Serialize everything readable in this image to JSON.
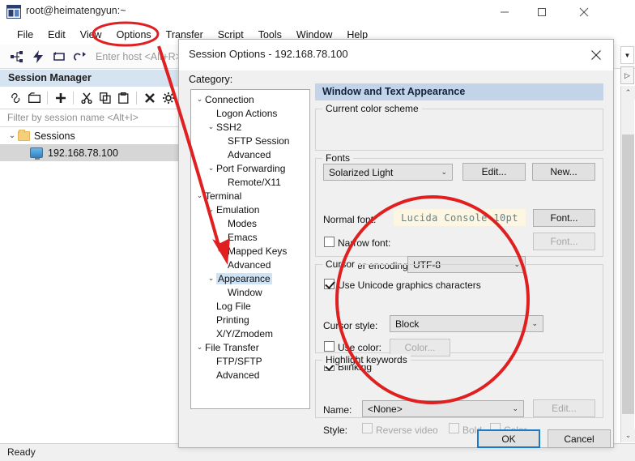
{
  "window": {
    "title": "root@heimatengyun:~",
    "app_icon": "terminal-window-icon",
    "minimize": "—",
    "maximize": "□",
    "close": "✕",
    "status": "Ready"
  },
  "menubar": {
    "items": [
      {
        "label": "File"
      },
      {
        "label": "Edit"
      },
      {
        "label": "View"
      },
      {
        "label": "Options"
      },
      {
        "label": "Transfer"
      },
      {
        "label": "Script"
      },
      {
        "label": "Tools"
      },
      {
        "label": "Window"
      },
      {
        "label": "Help"
      }
    ]
  },
  "toolbar": {
    "icons": [
      "connect-icon",
      "quick-connect-icon",
      "reconnect-icon",
      "connect-sftp-icon"
    ],
    "host_placeholder": "Enter host <Alt+R>"
  },
  "session_manager": {
    "header": "Session Manager",
    "toolbar_icons": [
      "link-icon",
      "new-folder-icon",
      "add-icon",
      "cut-icon",
      "copy-icon",
      "paste-icon",
      "delete-icon",
      "properties-gear-icon"
    ],
    "filter_placeholder": "Filter by session name <Alt+I>",
    "tree": {
      "root_label": "Sessions",
      "root_icon": "folder-icon",
      "root_chevron": "⌄",
      "children": [
        {
          "label": "192.168.78.100",
          "icon": "monitor-icon",
          "selected": true
        }
      ]
    }
  },
  "dialog": {
    "title": "Session Options - 192.168.78.100",
    "close_icon": "✕",
    "category_label": "Category:",
    "category_tree": [
      {
        "label": "Connection",
        "indent": 0,
        "chevron": "⌄"
      },
      {
        "label": "Logon Actions",
        "indent": 1,
        "chevron": ""
      },
      {
        "label": "SSH2",
        "indent": 1,
        "chevron": "⌄"
      },
      {
        "label": "SFTP Session",
        "indent": 2,
        "chevron": ""
      },
      {
        "label": "Advanced",
        "indent": 2,
        "chevron": ""
      },
      {
        "label": "Port Forwarding",
        "indent": 1,
        "chevron": "⌄"
      },
      {
        "label": "Remote/X11",
        "indent": 2,
        "chevron": ""
      },
      {
        "label": "Terminal",
        "indent": 0,
        "chevron": "⌄"
      },
      {
        "label": "Emulation",
        "indent": 1,
        "chevron": "⌄"
      },
      {
        "label": "Modes",
        "indent": 2,
        "chevron": ""
      },
      {
        "label": "Emacs",
        "indent": 2,
        "chevron": ""
      },
      {
        "label": "Mapped Keys",
        "indent": 2,
        "chevron": ""
      },
      {
        "label": "Advanced",
        "indent": 2,
        "chevron": ""
      },
      {
        "label": "Appearance",
        "indent": 1,
        "chevron": "⌄",
        "selected": true
      },
      {
        "label": "Window",
        "indent": 2,
        "chevron": ""
      },
      {
        "label": "Log File",
        "indent": 1,
        "chevron": ""
      },
      {
        "label": "Printing",
        "indent": 1,
        "chevron": ""
      },
      {
        "label": "X/Y/Zmodem",
        "indent": 1,
        "chevron": ""
      },
      {
        "label": "File Transfer",
        "indent": 0,
        "chevron": "⌄"
      },
      {
        "label": "FTP/SFTP",
        "indent": 1,
        "chevron": ""
      },
      {
        "label": "Advanced",
        "indent": 1,
        "chevron": ""
      }
    ],
    "pane_title": "Window and Text Appearance",
    "color_scheme": {
      "group_label": "Current color scheme",
      "value": "Solarized Light",
      "arrow": "⌄",
      "edit_button": "Edit...",
      "new_button": "New..."
    },
    "fonts": {
      "group_label": "Fonts",
      "normal_font_label": "Normal font:",
      "normal_font_value": "Lucida Console 10pt",
      "normal_font_button": "Font...",
      "narrow_font_label": "Narrow font:",
      "narrow_font_checked": false,
      "narrow_font_button": "Font...",
      "encoding_label": "Character encoding:",
      "encoding_value": "UTF-8",
      "encoding_arrow": "⌄",
      "unicode_label": "Use Unicode graphics characters",
      "unicode_checked": true
    },
    "cursor": {
      "group_label": "Cursor",
      "style_label": "Cursor style:",
      "style_value": "Block",
      "style_arrow": "⌄",
      "use_color_label": "Use color:",
      "use_color_checked": false,
      "color_button": "Color...",
      "blinking_label": "Blinking",
      "blinking_checked": true
    },
    "highlight": {
      "group_label": "Highlight keywords",
      "name_label": "Name:",
      "name_value": "<None>",
      "name_arrow": "⌄",
      "edit_button": "Edit...",
      "style_label": "Style:",
      "reverse_video_label": "Reverse video",
      "reverse_video_checked": false,
      "bold_label": "Bold",
      "bold_checked": false,
      "color_label": "Color",
      "color_checked": false
    },
    "ok_button": "OK",
    "cancel_button": "Cancel"
  },
  "scrollbars": {
    "top_dropdown_arrow": "▼",
    "tab_arrow": "▷",
    "up_arrow": "⌃",
    "down_arrow": "⌄"
  },
  "annotations": {
    "accent_color": "#e02020",
    "ellipse_options_menu": "red-ellipse-around-options-menu",
    "arrow_to_appearance": "red-arrow-pointing-to-appearance",
    "ellipse_settings": "red-circle-around-font-cursor-settings"
  }
}
